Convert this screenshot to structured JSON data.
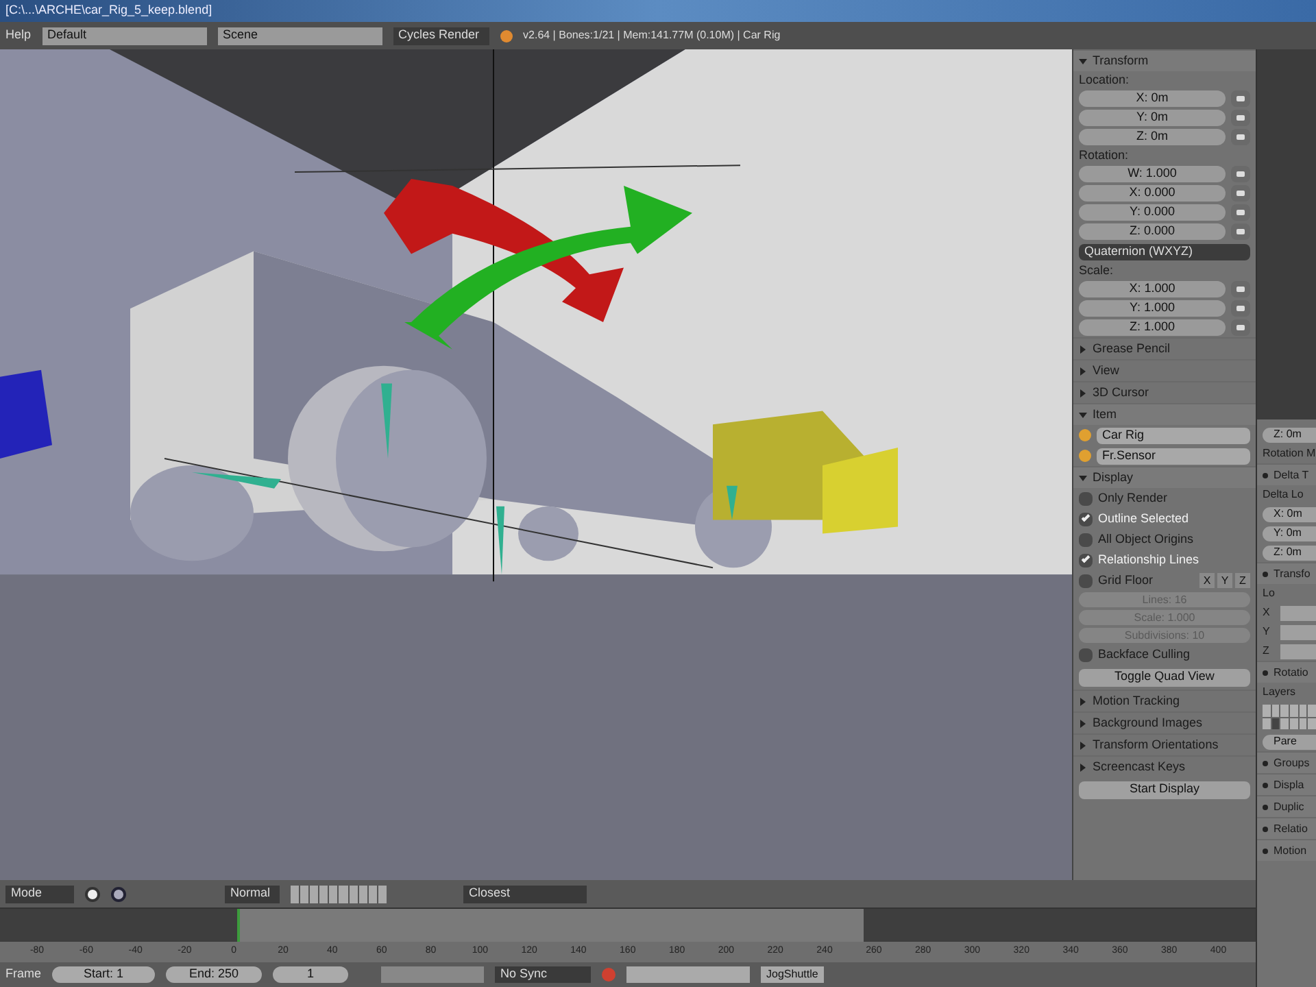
{
  "title_bar": {
    "title": "[C:\\...\\ARCHE\\car_Rig_5_keep.blend]"
  },
  "header": {
    "menu": "Help",
    "layout": "Default",
    "scene": "Scene",
    "engine": "Cycles Render",
    "stats": "v2.64 | Bones:1/21 | Mem:141.77M (0.10M) | Car Rig"
  },
  "n_panel": [
    {
      "kind": "section",
      "text": "Transform",
      "expanded": true
    },
    {
      "kind": "label",
      "text": "Location:"
    },
    {
      "kind": "vector_field",
      "text": "X: 0m"
    },
    {
      "kind": "vector_field",
      "text": "Y: 0m"
    },
    {
      "kind": "vector_field",
      "text": "Z: 0m"
    },
    {
      "kind": "label",
      "text": "Rotation:"
    },
    {
      "kind": "vector_field",
      "text": "W: 1.000"
    },
    {
      "kind": "vector_field",
      "text": "X: 0.000"
    },
    {
      "kind": "vector_field",
      "text": "Y: 0.000"
    },
    {
      "kind": "vector_field",
      "text": "Z: 0.000"
    },
    {
      "kind": "dropdown",
      "text": "Quaternion (WXYZ)"
    },
    {
      "kind": "label",
      "text": "Scale:"
    },
    {
      "kind": "vector_field",
      "text": "X: 1.000"
    },
    {
      "kind": "vector_field",
      "text": "Y: 1.000"
    },
    {
      "kind": "vector_field",
      "text": "Z: 1.000"
    },
    {
      "kind": "section",
      "text": "Grease Pencil",
      "expanded": false
    },
    {
      "kind": "section",
      "text": "View",
      "expanded": false
    },
    {
      "kind": "section",
      "text": "3D Cursor",
      "expanded": false
    },
    {
      "kind": "section",
      "text": "Item",
      "expanded": true
    },
    {
      "kind": "name_field",
      "text": "Car Rig"
    },
    {
      "kind": "name_field",
      "text": "Fr.Sensor"
    },
    {
      "kind": "section",
      "text": "Display",
      "expanded": true
    },
    {
      "kind": "checkbox",
      "text": "Only Render",
      "checked": false
    },
    {
      "kind": "checkbox",
      "text": "Outline Selected",
      "checked": true
    },
    {
      "kind": "checkbox",
      "text": "All Object Origins",
      "checked": false
    },
    {
      "kind": "checkbox",
      "text": "Relationship Lines",
      "checked": true
    },
    {
      "kind": "checkbox",
      "text": "Grid Floor",
      "checked": false,
      "toggles": [
        "X",
        "Y",
        "Z"
      ]
    },
    {
      "kind": "disabled_field",
      "text": "Lines: 16"
    },
    {
      "kind": "disabled_field",
      "text": "Scale: 1.000"
    },
    {
      "kind": "disabled_field",
      "text": "Subdivisions: 10"
    },
    {
      "kind": "checkbox",
      "text": "Backface Culling",
      "checked": false
    },
    {
      "kind": "button",
      "text": "Toggle Quad View"
    },
    {
      "kind": "section",
      "text": "Motion Tracking",
      "expanded": false
    },
    {
      "kind": "section",
      "text": "Background Images",
      "expanded": false
    },
    {
      "kind": "section",
      "text": "Transform Orientations",
      "expanded": false
    },
    {
      "kind": "section",
      "text": "Screencast Keys",
      "expanded": false
    },
    {
      "kind": "button",
      "text": "Start Display"
    }
  ],
  "properties": [
    {
      "kind": "field",
      "text": "Z: 0m"
    },
    {
      "kind": "label",
      "text": "Rotation M"
    },
    {
      "kind": "section",
      "text": "Delta T"
    },
    {
      "kind": "label",
      "text": "Delta Lo"
    },
    {
      "kind": "field",
      "text": "X: 0m"
    },
    {
      "kind": "field",
      "text": "Y: 0m"
    },
    {
      "kind": "field",
      "text": "Z: 0m"
    },
    {
      "kind": "section",
      "text": "Transfo"
    },
    {
      "kind": "label",
      "text": "Lo"
    },
    {
      "kind": "axis_field",
      "text": "X"
    },
    {
      "kind": "axis_field",
      "text": "Y"
    },
    {
      "kind": "axis_field",
      "text": "Z"
    },
    {
      "kind": "section",
      "text": "Rotatio"
    },
    {
      "kind": "label",
      "text": "Layers"
    },
    {
      "kind": "layers"
    },
    {
      "kind": "field",
      "text": "Pare"
    },
    {
      "kind": "section",
      "text": "Groups"
    },
    {
      "kind": "section",
      "text": "Displa"
    },
    {
      "kind": "section",
      "text": "Duplic"
    },
    {
      "kind": "section",
      "text": "Relatio"
    },
    {
      "kind": "section",
      "text": "Motion"
    }
  ],
  "view_header": {
    "mode": "Mode",
    "pivot": "Normal",
    "snap": "Closest"
  },
  "ruler": [
    "-80",
    "-60",
    "-40",
    "-20",
    "0",
    "20",
    "40",
    "60",
    "80",
    "100",
    "120",
    "140",
    "160",
    "180",
    "200",
    "220",
    "240",
    "260",
    "280",
    "300",
    "320",
    "340",
    "360",
    "380",
    "400"
  ],
  "timeline_header": {
    "menu": "Frame",
    "start": "Start: 1",
    "end": "End: 250",
    "current": "1",
    "sync": "No Sync",
    "keying": "JogShuttle"
  }
}
